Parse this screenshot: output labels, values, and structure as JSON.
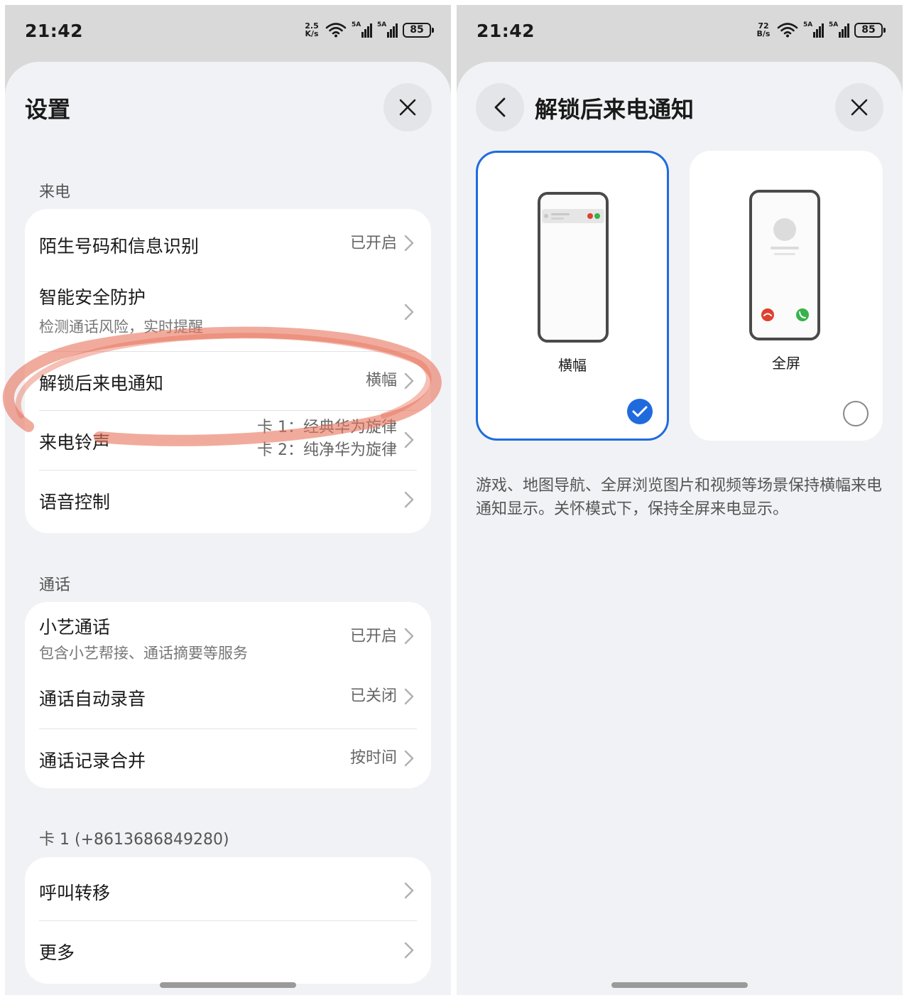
{
  "status": {
    "left": {
      "time": "21:42",
      "speed": "2.5\nK/s",
      "signal1": "5A",
      "signal2": "5A",
      "battery": "85"
    },
    "right": {
      "time": "21:42",
      "speed": "72\nB/s",
      "signal1": "5A",
      "signal2": "5A",
      "battery": "85"
    }
  },
  "settings": {
    "title": "设置",
    "sections": [
      {
        "label": "来电",
        "rows": [
          {
            "title": "陌生号码和信息识别",
            "value": "已开启"
          },
          {
            "title": "智能安全防护",
            "subtitle": "检测通话风险，实时提醒"
          },
          {
            "title": "解锁后来电通知",
            "value": "横幅"
          },
          {
            "title": "来电铃声",
            "value_line1": "卡 1：经典华为旋律",
            "value_line2": "卡 2：纯净华为旋律"
          },
          {
            "title": "语音控制"
          }
        ]
      },
      {
        "label": "通话",
        "rows": [
          {
            "title": "小艺通话",
            "subtitle": "包含小艺帮接、通话摘要等服务",
            "value": "已开启"
          },
          {
            "title": "通话自动录音",
            "value": "已关闭"
          },
          {
            "title": "通话记录合并",
            "value": "按时间"
          }
        ]
      },
      {
        "label": "卡 1 (+8613686849280)",
        "rows": [
          {
            "title": "呼叫转移"
          },
          {
            "title": "更多"
          }
        ]
      }
    ]
  },
  "detail": {
    "title": "解锁后来电通知",
    "options": [
      {
        "label": "横幅",
        "selected": true
      },
      {
        "label": "全屏",
        "selected": false
      }
    ],
    "description": "游戏、地图导航、全屏浏览图片和视频等场景保持横幅来电通知显示。关怀模式下，保持全屏来电显示。"
  },
  "colors": {
    "accent": "#1f6bde",
    "annotation": "#e8735c",
    "decline": "#e0402e",
    "accept": "#38b24a"
  }
}
